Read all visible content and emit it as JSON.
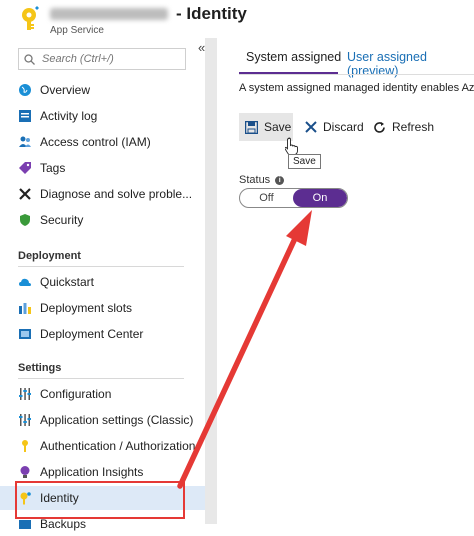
{
  "header": {
    "title": "- Identity",
    "subtitle": "App Service"
  },
  "search": {
    "placeholder": "Search (Ctrl+/)"
  },
  "sidebar": {
    "collapse": "«",
    "items": [
      {
        "label": "Overview"
      },
      {
        "label": "Activity log"
      },
      {
        "label": "Access control (IAM)"
      },
      {
        "label": "Tags"
      },
      {
        "label": "Diagnose and solve proble..."
      },
      {
        "label": "Security"
      }
    ],
    "deployment_heading": "Deployment",
    "deployment_items": [
      {
        "label": "Quickstart"
      },
      {
        "label": "Deployment slots"
      },
      {
        "label": "Deployment Center"
      }
    ],
    "settings_heading": "Settings",
    "settings_items": [
      {
        "label": "Configuration"
      },
      {
        "label": "Application settings (Classic)"
      },
      {
        "label": "Authentication / Authorization"
      },
      {
        "label": "Application Insights"
      },
      {
        "label": "Identity"
      },
      {
        "label": "Backups"
      }
    ]
  },
  "tabs": [
    {
      "label": "System assigned"
    },
    {
      "label": "User assigned (preview)"
    }
  ],
  "description": "A system assigned managed identity enables Azu",
  "toolbar": {
    "save": "Save",
    "discard": "Discard",
    "refresh": "Refresh",
    "tooltip": "Save"
  },
  "status": {
    "label": "Status",
    "info": "i",
    "off": "Off",
    "on": "On"
  },
  "colors": {
    "accent": "#5c2d91",
    "link": "#1a6fb5",
    "highlight": "#e53935",
    "active_bg": "#dde9f7"
  }
}
